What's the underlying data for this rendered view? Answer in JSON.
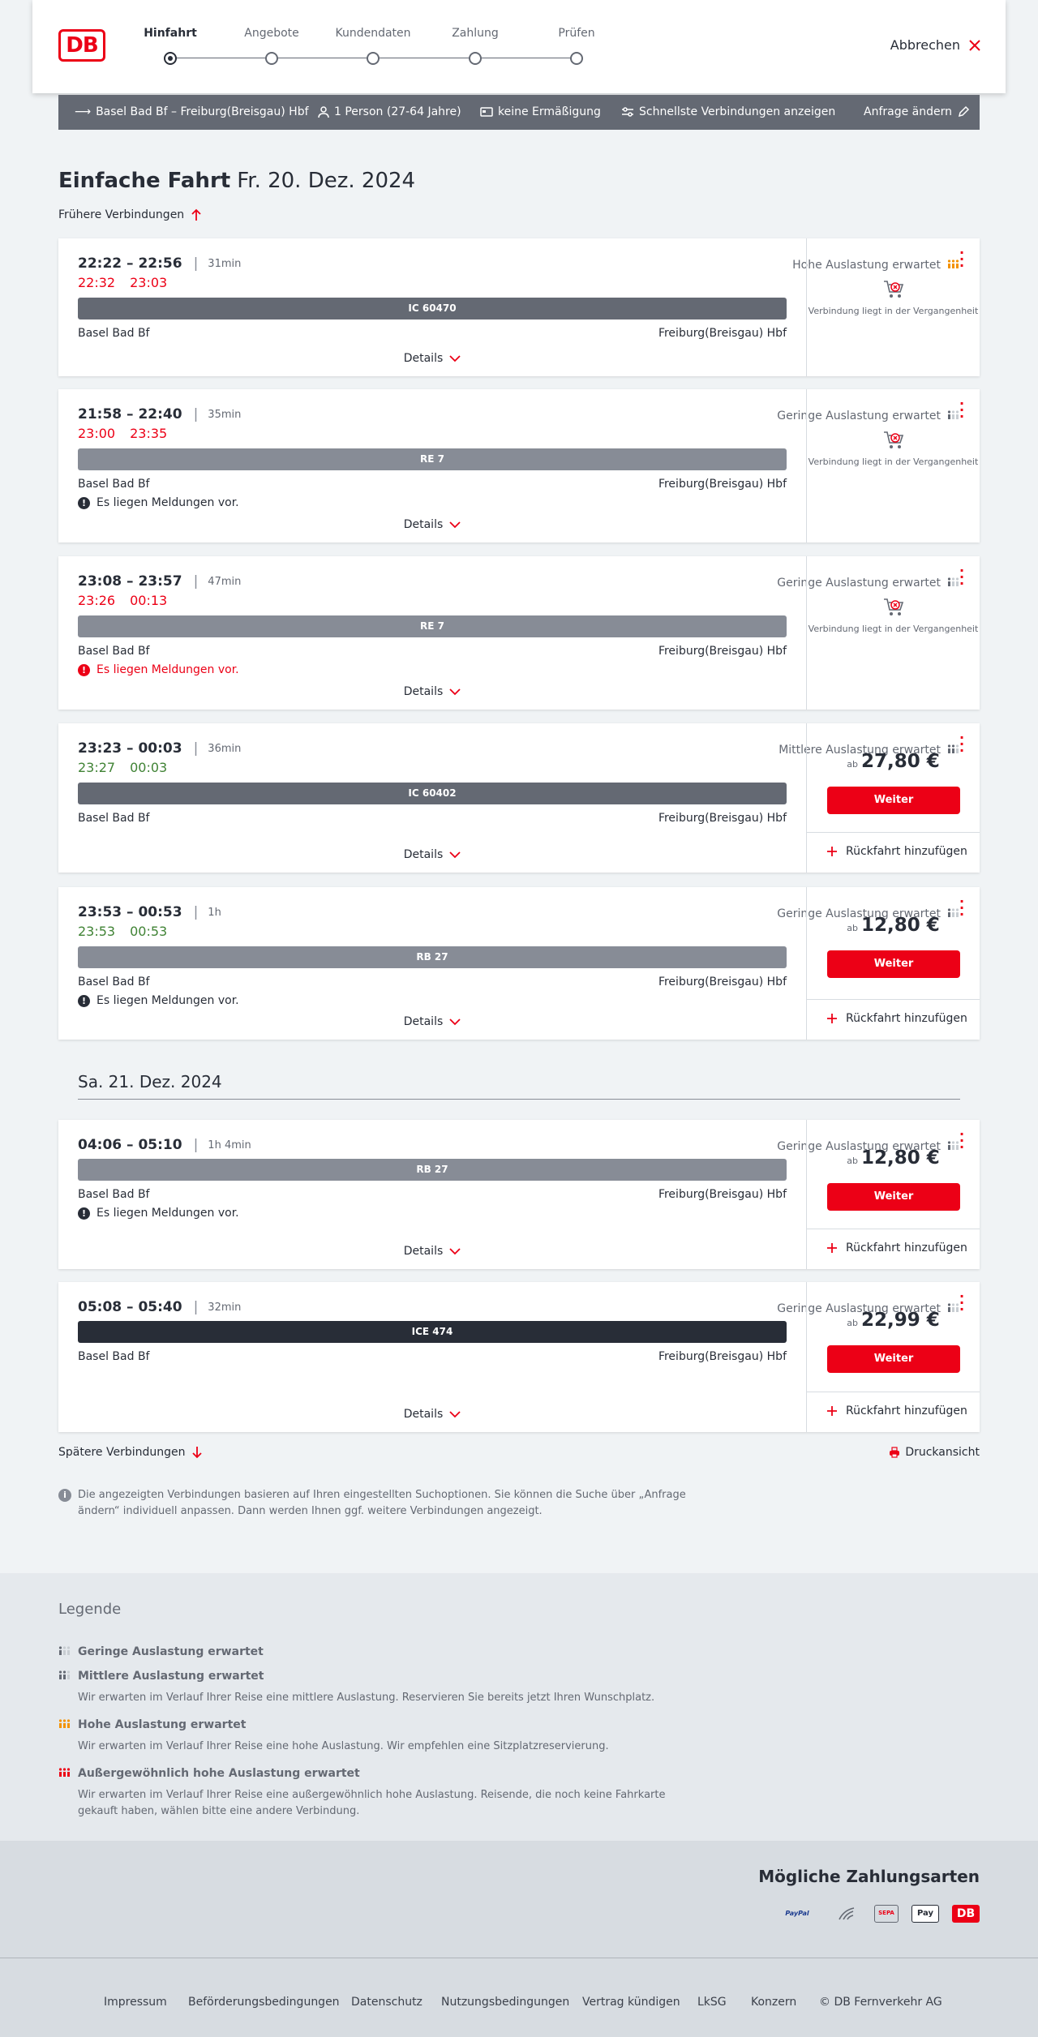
{
  "header": {
    "logo": "DB",
    "steps": [
      "Hinfahrt",
      "Angebote",
      "Kundendaten",
      "Zahlung",
      "Prüfen"
    ],
    "cancel": "Abbrechen"
  },
  "summary": {
    "route": "Basel Bad Bf – Freiburg(Breisgau) Hbf",
    "travellers": "1 Person (27-64 Jahre)",
    "discount": "keine Ermäßigung",
    "fastest": "Schnellste Verbindungen anzeigen",
    "change": "Anfrage ändern"
  },
  "page": {
    "title": "Einfache Fahrt",
    "date": "Fr. 20. Dez. 2024",
    "earlier": "Frühere Verbindungen",
    "later": "Spätere Verbindungen",
    "day2": "Sa. 21. Dez. 2024",
    "print": "Druckansicht",
    "info": "Die angezeigten Verbindungen basieren auf Ihren eingestellten Suchoptionen. Sie können die Suche über „Anfrage ändern“ individuell anpassen. Dann werden Ihnen ggf. weitere Verbindungen angezeigt."
  },
  "labels": {
    "details": "Details",
    "past": "Verbindung liegt in der Vergangenheit",
    "ab": "ab",
    "weiter": "Weiter",
    "return": "Rückfahrt hinzufügen",
    "from": "Basel Bad Bf",
    "to": "Freiburg(Breisgau) Hbf"
  },
  "connections": [
    {
      "times": "22:22 – 22:56",
      "duration": "31min",
      "rt_dep": "22:32",
      "rt_arr": "23:03",
      "rt_status": "red",
      "load": "Hohe Auslastung erwartet",
      "load_level": "high",
      "train": "IC 60470",
      "train_color": "dark",
      "message": "",
      "state": "past"
    },
    {
      "times": "21:58 – 22:40",
      "duration": "35min",
      "rt_dep": "23:00",
      "rt_arr": "23:35",
      "rt_status": "red",
      "load": "Geringe Auslastung erwartet",
      "load_level": "low",
      "train": "RE 7",
      "train_color": "mid",
      "message": "Es liegen Meldungen vor.",
      "message_style": "info",
      "state": "past"
    },
    {
      "times": "23:08 – 23:57",
      "duration": "47min",
      "rt_dep": "23:26",
      "rt_arr": "00:13",
      "rt_status": "red",
      "load": "Geringe Auslastung erwartet",
      "load_level": "low",
      "train": "RE 7",
      "train_color": "mid",
      "message": "Es liegen Meldungen vor.",
      "message_style": "warn",
      "state": "past"
    },
    {
      "times": "23:23 – 00:03",
      "duration": "36min",
      "rt_dep": "23:27",
      "rt_arr": "00:03",
      "rt_status": "green",
      "load": "Mittlere Auslastung erwartet",
      "load_level": "medium",
      "train": "IC 60402",
      "train_color": "dark",
      "message": "",
      "price": "27,80 €",
      "state": "bookable"
    },
    {
      "times": "23:53 – 00:53",
      "duration": "1h",
      "rt_dep": "23:53",
      "rt_arr": "00:53",
      "rt_status": "green",
      "load": "Geringe Auslastung erwartet",
      "load_level": "low",
      "train": "RB 27",
      "train_color": "mid",
      "message": "Es liegen Meldungen vor.",
      "message_style": "info",
      "price": "12,80 €",
      "state": "bookable"
    },
    {
      "times": "04:06 – 05:10",
      "duration": "1h 4min",
      "rt_dep": "",
      "rt_arr": "",
      "load": "Geringe Auslastung erwartet",
      "load_level": "low",
      "train": "RB 27",
      "train_color": "mid",
      "message": "Es liegen Meldungen vor.",
      "message_style": "info",
      "price": "12,80 €",
      "state": "bookable"
    },
    {
      "times": "05:08 – 05:40",
      "duration": "32min",
      "rt_dep": "",
      "rt_arr": "",
      "load": "Geringe Auslastung erwartet",
      "load_level": "low",
      "train": "ICE 474",
      "train_color": "black",
      "message": "",
      "price": "22,99 €",
      "state": "bookable"
    }
  ],
  "legend": {
    "title": "Legende",
    "items": [
      {
        "title": "Geringe Auslastung erwartet",
        "desc": ""
      },
      {
        "title": "Mittlere Auslastung erwartet",
        "desc": "Wir erwarten im Verlauf Ihrer Reise eine mittlere Auslastung. Reservieren Sie bereits jetzt Ihren Wunschplatz."
      },
      {
        "title": "Hohe Auslastung erwartet",
        "desc": "Wir erwarten im Verlauf Ihrer Reise eine hohe Auslastung. Wir empfehlen eine Sitzplatzreservierung."
      },
      {
        "title": "Außergewöhnlich hohe Auslastung erwartet",
        "desc": "Wir erwarten im Verlauf Ihrer Reise eine außergewöhnlich hohe Auslastung. Reisende, die noch keine Fahrkarte gekauft haben, wählen bitte eine andere Verbindung."
      }
    ]
  },
  "payment": {
    "title": "Mögliche Zahlungsarten",
    "methods": [
      "PayPal",
      "Lastschrift",
      "SEPA",
      "Pay",
      "DB"
    ]
  },
  "footer": {
    "links": [
      "Impressum",
      "Beförderungsbedingungen",
      "Datenschutz",
      "Nutzungsbedingungen",
      "Vertrag kündigen",
      "LkSG",
      "Konzern",
      "© DB Fernverkehr AG"
    ]
  },
  "colors": {
    "brand": "#ec0016",
    "delay": "#ec0016",
    "ontime": "#408335",
    "load_high": "#f39200"
  }
}
